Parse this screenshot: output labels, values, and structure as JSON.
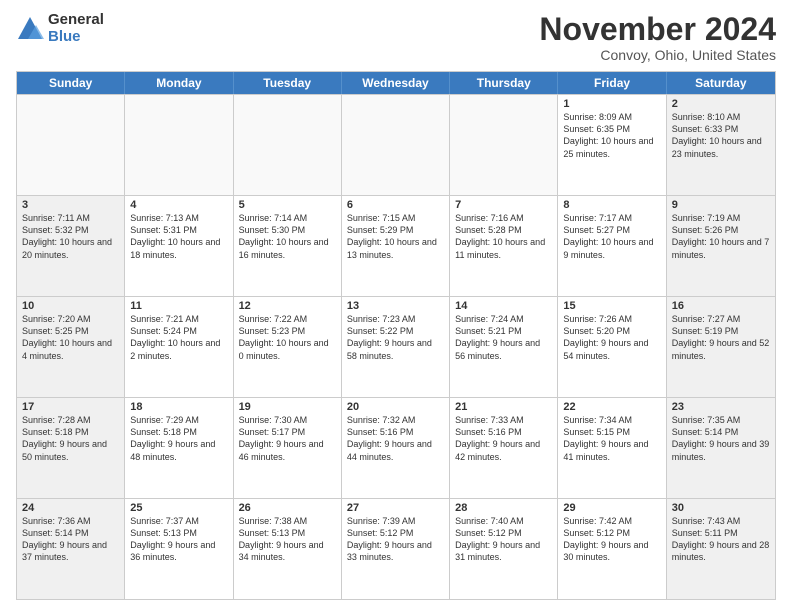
{
  "logo": {
    "general": "General",
    "blue": "Blue"
  },
  "title": "November 2024",
  "location": "Convoy, Ohio, United States",
  "days_of_week": [
    "Sunday",
    "Monday",
    "Tuesday",
    "Wednesday",
    "Thursday",
    "Friday",
    "Saturday"
  ],
  "weeks": [
    [
      {
        "day": "",
        "info": ""
      },
      {
        "day": "",
        "info": ""
      },
      {
        "day": "",
        "info": ""
      },
      {
        "day": "",
        "info": ""
      },
      {
        "day": "",
        "info": ""
      },
      {
        "day": "1",
        "info": "Sunrise: 8:09 AM\nSunset: 6:35 PM\nDaylight: 10 hours and 25 minutes."
      },
      {
        "day": "2",
        "info": "Sunrise: 8:10 AM\nSunset: 6:33 PM\nDaylight: 10 hours and 23 minutes."
      }
    ],
    [
      {
        "day": "3",
        "info": "Sunrise: 7:11 AM\nSunset: 5:32 PM\nDaylight: 10 hours and 20 minutes."
      },
      {
        "day": "4",
        "info": "Sunrise: 7:13 AM\nSunset: 5:31 PM\nDaylight: 10 hours and 18 minutes."
      },
      {
        "day": "5",
        "info": "Sunrise: 7:14 AM\nSunset: 5:30 PM\nDaylight: 10 hours and 16 minutes."
      },
      {
        "day": "6",
        "info": "Sunrise: 7:15 AM\nSunset: 5:29 PM\nDaylight: 10 hours and 13 minutes."
      },
      {
        "day": "7",
        "info": "Sunrise: 7:16 AM\nSunset: 5:28 PM\nDaylight: 10 hours and 11 minutes."
      },
      {
        "day": "8",
        "info": "Sunrise: 7:17 AM\nSunset: 5:27 PM\nDaylight: 10 hours and 9 minutes."
      },
      {
        "day": "9",
        "info": "Sunrise: 7:19 AM\nSunset: 5:26 PM\nDaylight: 10 hours and 7 minutes."
      }
    ],
    [
      {
        "day": "10",
        "info": "Sunrise: 7:20 AM\nSunset: 5:25 PM\nDaylight: 10 hours and 4 minutes."
      },
      {
        "day": "11",
        "info": "Sunrise: 7:21 AM\nSunset: 5:24 PM\nDaylight: 10 hours and 2 minutes."
      },
      {
        "day": "12",
        "info": "Sunrise: 7:22 AM\nSunset: 5:23 PM\nDaylight: 10 hours and 0 minutes."
      },
      {
        "day": "13",
        "info": "Sunrise: 7:23 AM\nSunset: 5:22 PM\nDaylight: 9 hours and 58 minutes."
      },
      {
        "day": "14",
        "info": "Sunrise: 7:24 AM\nSunset: 5:21 PM\nDaylight: 9 hours and 56 minutes."
      },
      {
        "day": "15",
        "info": "Sunrise: 7:26 AM\nSunset: 5:20 PM\nDaylight: 9 hours and 54 minutes."
      },
      {
        "day": "16",
        "info": "Sunrise: 7:27 AM\nSunset: 5:19 PM\nDaylight: 9 hours and 52 minutes."
      }
    ],
    [
      {
        "day": "17",
        "info": "Sunrise: 7:28 AM\nSunset: 5:18 PM\nDaylight: 9 hours and 50 minutes."
      },
      {
        "day": "18",
        "info": "Sunrise: 7:29 AM\nSunset: 5:18 PM\nDaylight: 9 hours and 48 minutes."
      },
      {
        "day": "19",
        "info": "Sunrise: 7:30 AM\nSunset: 5:17 PM\nDaylight: 9 hours and 46 minutes."
      },
      {
        "day": "20",
        "info": "Sunrise: 7:32 AM\nSunset: 5:16 PM\nDaylight: 9 hours and 44 minutes."
      },
      {
        "day": "21",
        "info": "Sunrise: 7:33 AM\nSunset: 5:16 PM\nDaylight: 9 hours and 42 minutes."
      },
      {
        "day": "22",
        "info": "Sunrise: 7:34 AM\nSunset: 5:15 PM\nDaylight: 9 hours and 41 minutes."
      },
      {
        "day": "23",
        "info": "Sunrise: 7:35 AM\nSunset: 5:14 PM\nDaylight: 9 hours and 39 minutes."
      }
    ],
    [
      {
        "day": "24",
        "info": "Sunrise: 7:36 AM\nSunset: 5:14 PM\nDaylight: 9 hours and 37 minutes."
      },
      {
        "day": "25",
        "info": "Sunrise: 7:37 AM\nSunset: 5:13 PM\nDaylight: 9 hours and 36 minutes."
      },
      {
        "day": "26",
        "info": "Sunrise: 7:38 AM\nSunset: 5:13 PM\nDaylight: 9 hours and 34 minutes."
      },
      {
        "day": "27",
        "info": "Sunrise: 7:39 AM\nSunset: 5:12 PM\nDaylight: 9 hours and 33 minutes."
      },
      {
        "day": "28",
        "info": "Sunrise: 7:40 AM\nSunset: 5:12 PM\nDaylight: 9 hours and 31 minutes."
      },
      {
        "day": "29",
        "info": "Sunrise: 7:42 AM\nSunset: 5:12 PM\nDaylight: 9 hours and 30 minutes."
      },
      {
        "day": "30",
        "info": "Sunrise: 7:43 AM\nSunset: 5:11 PM\nDaylight: 9 hours and 28 minutes."
      }
    ]
  ]
}
